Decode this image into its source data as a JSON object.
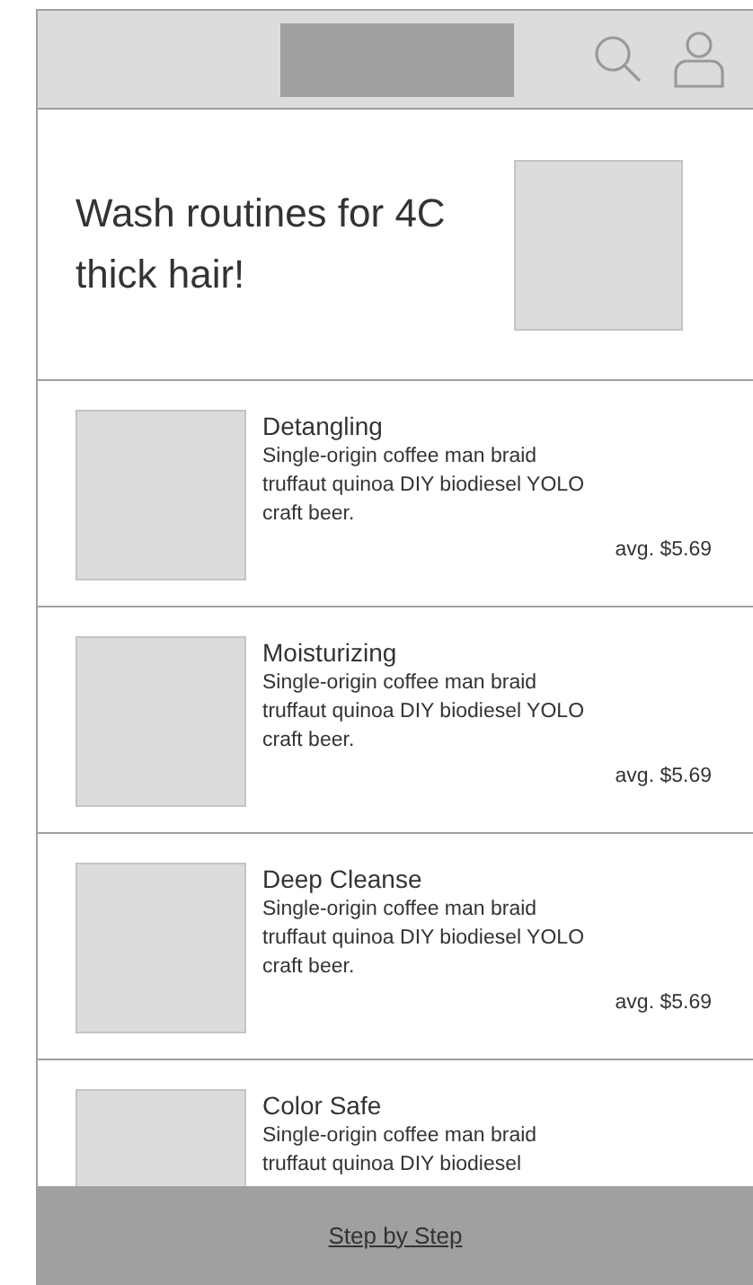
{
  "hero": {
    "title": "Wash routines for 4C thick hair!"
  },
  "routines": [
    {
      "name": "Detangling",
      "description": "Single-origin coffee man braid truffaut quinoa DIY biodiesel YOLO craft beer.",
      "price": "avg. $5.69"
    },
    {
      "name": "Moisturizing",
      "description": "Single-origin coffee man braid truffaut quinoa DIY biodiesel YOLO craft beer.",
      "price": "avg. $5.69"
    },
    {
      "name": "Deep Cleanse",
      "description": "Single-origin coffee man braid truffaut quinoa DIY biodiesel YOLO craft beer.",
      "price": "avg. $5.69"
    },
    {
      "name": "Color Safe",
      "description": "Single-origin coffee man braid truffaut quinoa DIY biodiesel"
    }
  ],
  "footer": {
    "link": "Step by Step"
  }
}
